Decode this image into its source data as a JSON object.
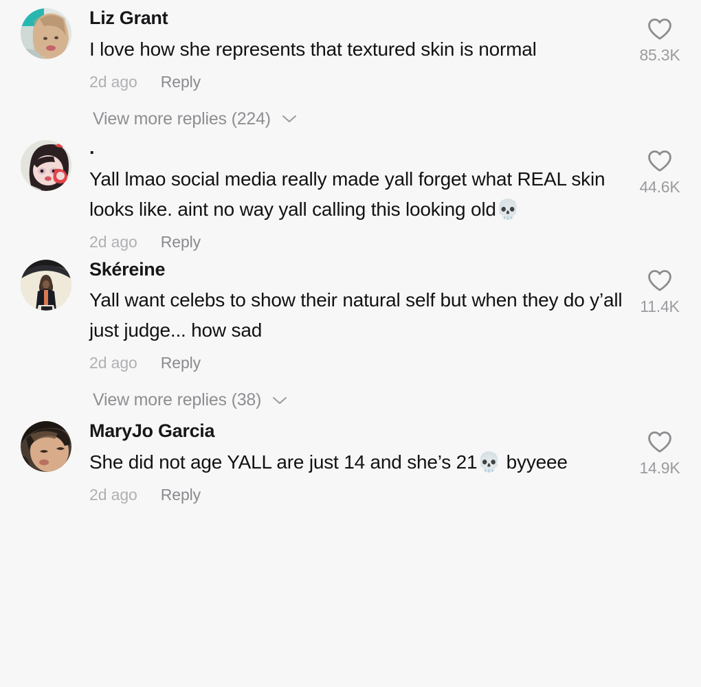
{
  "app": {
    "screen_name": "comments-feed",
    "background_color": "#f7f7f7",
    "text_color": "#121213",
    "muted_color": "#8e8e93"
  },
  "comments": [
    {
      "username": "Liz Grant",
      "text": "I love how she represents that textured skin is normal",
      "time": "2d ago",
      "reply_label": "Reply",
      "like_count": "85.3K",
      "like_icon": "heart-outline-icon",
      "avatar": "avatar-liz-grant",
      "view_more_replies": "View more replies (224)",
      "has_view_more": true
    },
    {
      "username": ".",
      "text": "Yall lmao social media really made yall forget what REAL skin looks like. aint no way yall calling this looking old💀",
      "time": "2d ago",
      "reply_label": "Reply",
      "like_count": "44.6K",
      "like_icon": "heart-outline-icon",
      "avatar": "avatar-dot-user",
      "view_more_replies": "",
      "has_view_more": false
    },
    {
      "username": "Skéreine",
      "text": "Yall want celebs to show their natural self but when they do y’all just judge... how sad",
      "time": "2d ago",
      "reply_label": "Reply",
      "like_count": "11.4K",
      "like_icon": "heart-outline-icon",
      "avatar": "avatar-skereine",
      "view_more_replies": "View more replies (38)",
      "has_view_more": true
    },
    {
      "username": "MaryJo Garcia",
      "text": "She did not age YALL are just 14 and she’s 21💀 byyeee",
      "time": "2d ago",
      "reply_label": "Reply",
      "like_count": "14.9K",
      "like_icon": "heart-outline-icon",
      "avatar": "avatar-maryjo-garcia",
      "view_more_replies": "",
      "has_view_more": false
    }
  ]
}
